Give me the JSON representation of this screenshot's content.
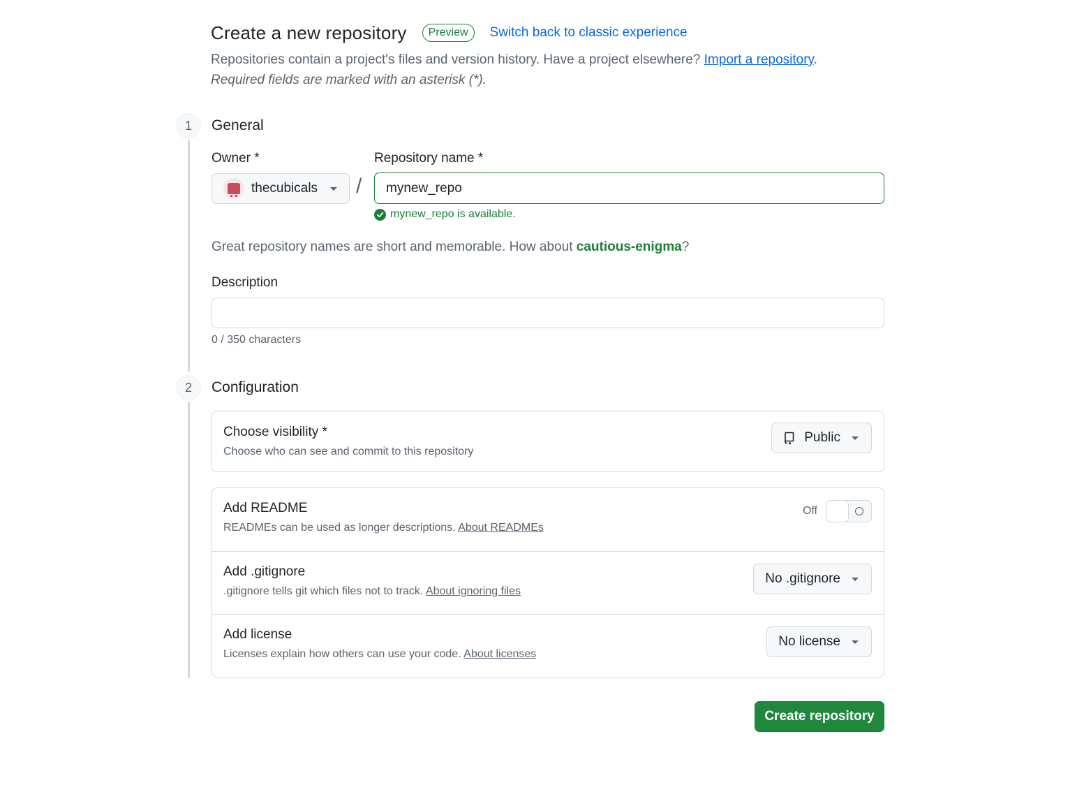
{
  "header": {
    "title": "Create a new repository",
    "badge": "Preview",
    "switch_link": "Switch back to classic experience",
    "subtitle": "Repositories contain a project's files and version history. Have a project elsewhere? ",
    "import_link": "Import a repository",
    "subtitle_end": ".",
    "required_note": "Required fields are marked with an asterisk (*)."
  },
  "steps": {
    "general": {
      "number": "1",
      "title": "General"
    },
    "configuration": {
      "number": "2",
      "title": "Configuration"
    }
  },
  "general": {
    "owner_label": "Owner *",
    "owner_value": "thecubicals",
    "slash": "/",
    "repo_label": "Repository name *",
    "repo_value": "mynew_repo",
    "availability": "mynew_repo is available.",
    "suggestion_prefix": "Great repository names are short and memorable. How about ",
    "suggestion_name": "cautious-enigma",
    "suggestion_suffix": "?",
    "description_label": "Description",
    "description_value": "",
    "char_count": "0 / 350 characters"
  },
  "configuration": {
    "visibility": {
      "title": "Choose visibility *",
      "desc": "Choose who can see and commit to this repository",
      "value": "Public"
    },
    "readme": {
      "title": "Add README",
      "desc": "READMEs can be used as longer descriptions. ",
      "link": "About READMEs",
      "toggle_label": "Off"
    },
    "gitignore": {
      "title": "Add .gitignore",
      "desc": ".gitignore tells git which files not to track. ",
      "link": "About ignoring files",
      "value": "No .gitignore"
    },
    "license": {
      "title": "Add license",
      "desc": "Licenses explain how others can use your code. ",
      "link": "About licenses",
      "value": "No license"
    }
  },
  "actions": {
    "create": "Create repository"
  },
  "colors": {
    "accent_green": "#1f883d",
    "link_blue": "#0969da",
    "muted": "#59636e",
    "border": "#d1d9e0"
  }
}
